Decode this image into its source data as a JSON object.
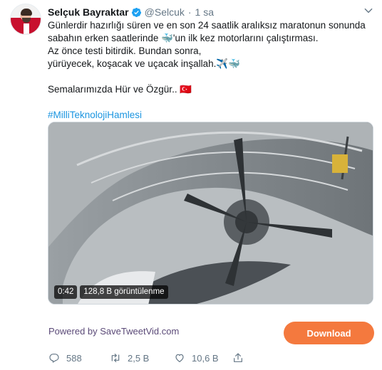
{
  "tweet": {
    "author_name": "Selçuk Bayraktar",
    "handle": "@Selcuk",
    "separator": "·",
    "time": "1 sa",
    "lines": [
      "Günlerdir hazırlığı süren ve en son 24 saatlik aralıksız maratonun sonunda",
      "sabahın erken saatlerinde 🐳'un ilk kez motorlarını çalıştırması.",
      "Az önce testi bitirdik. Bundan sonra,",
      "yürüyecek, koşacak ve uçacak inşallah.✈️🐳",
      "",
      "Semalarımızda Hür ve Özgür.. 🇹🇷",
      "",
      "#MilliTeknolojiHamlesi"
    ]
  },
  "video": {
    "duration": "0:42",
    "views": "128,8 B görüntülenme"
  },
  "embed": {
    "powered_by": "Powered by SaveTweetVid.com",
    "download_label": "Download",
    "accent_color": "#f4793e"
  },
  "actions": {
    "replies": "588",
    "retweets": "2,5 B",
    "likes": "10,6 B"
  },
  "icons": [
    "verified-badge-icon",
    "chevron-down-icon",
    "reply-icon",
    "retweet-icon",
    "like-icon",
    "share-icon"
  ]
}
